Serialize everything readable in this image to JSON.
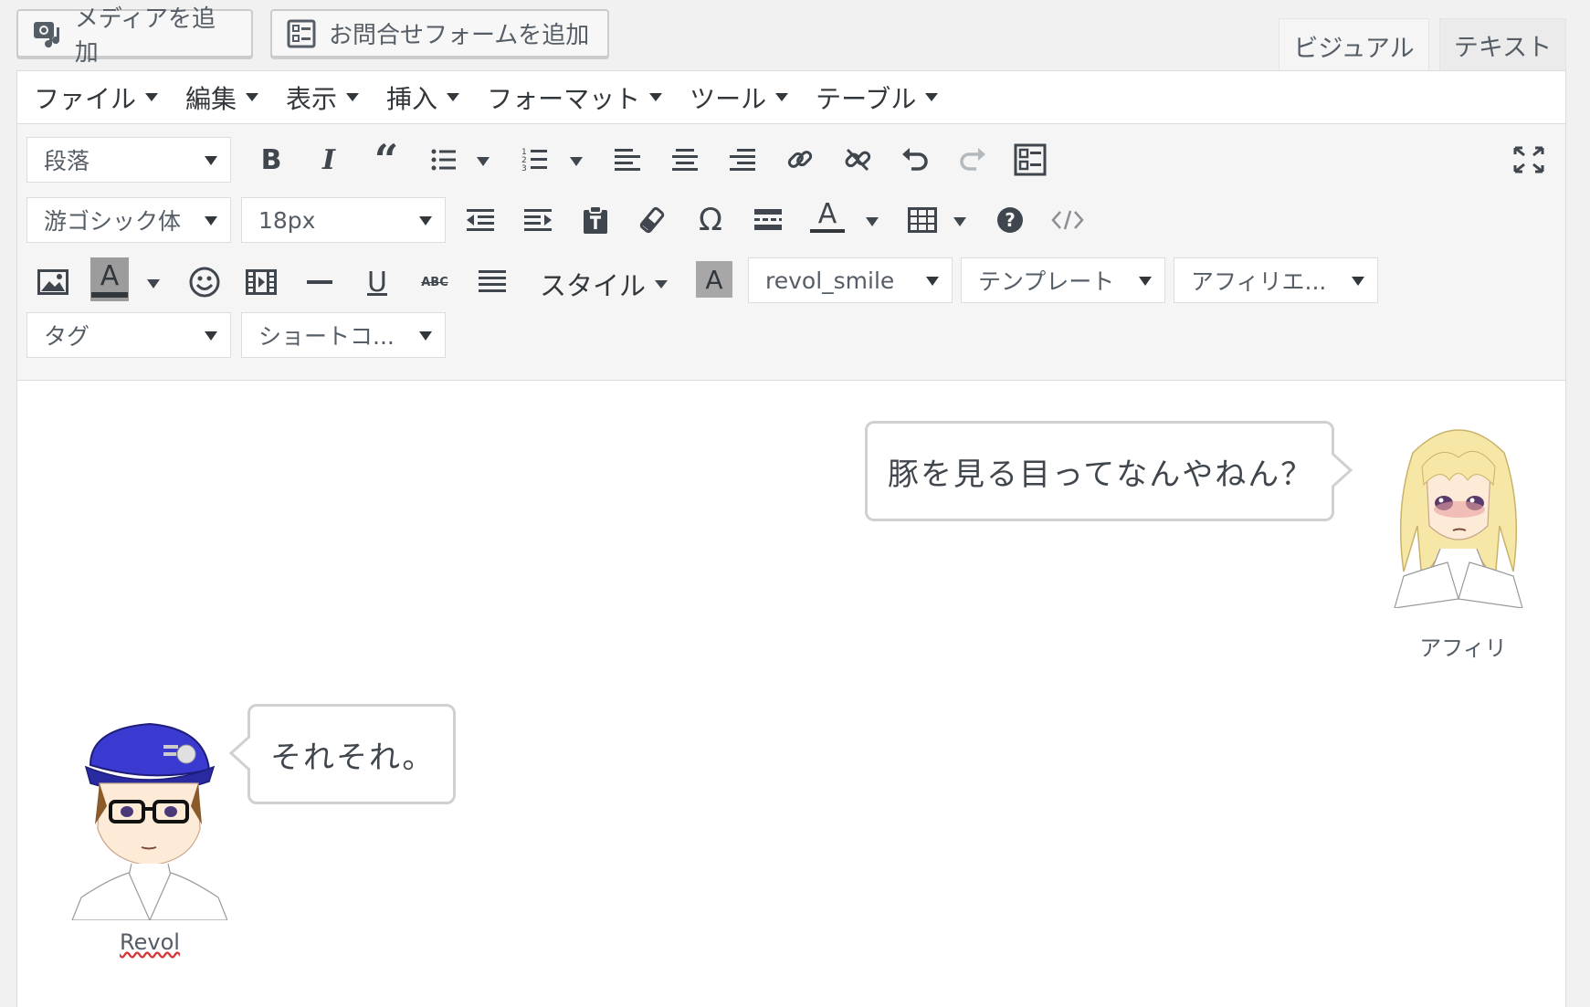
{
  "media_buttons": {
    "add_media": "メディアを追加",
    "add_form": "お問合せフォームを追加"
  },
  "tabs": {
    "visual": "ビジュアル",
    "text": "テキスト"
  },
  "menubar": [
    {
      "label": "ファイル"
    },
    {
      "label": "編集"
    },
    {
      "label": "表示"
    },
    {
      "label": "挿入"
    },
    {
      "label": "フォーマット"
    },
    {
      "label": "ツール"
    },
    {
      "label": "テーブル"
    }
  ],
  "toolbar": {
    "format_select": "段落",
    "font_family_select": "游ゴシック体",
    "font_size_select": "18px",
    "styles_label": "スタイル",
    "balloon_select": "revol_smile",
    "template_select": "テンプレート",
    "affiliate_select": "アフィリエ...",
    "tag_select": "タグ",
    "shortcode_select": "ショートコ..."
  },
  "content": {
    "bubble_right": {
      "text": "豚を見る目ってなんやねん？",
      "name": "アフィリ"
    },
    "bubble_left": {
      "text": "それそれ。",
      "name": "Revol"
    }
  },
  "colors": {
    "cap": "#3a3ad0",
    "hair_blonde": "#f6e7a6",
    "bubble_border": "#d0d0d0"
  }
}
